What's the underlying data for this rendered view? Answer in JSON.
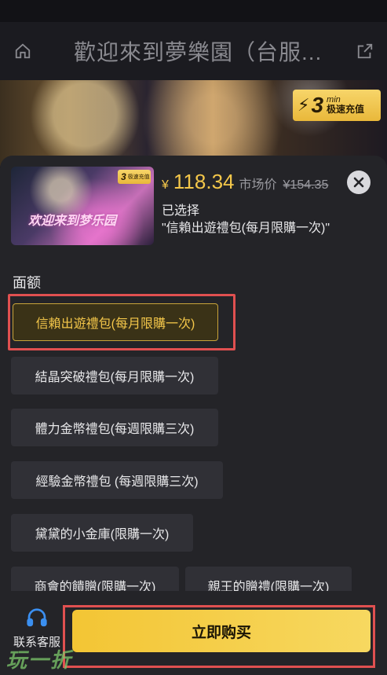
{
  "header": {
    "title": "歡迎來到夢樂園（台服..."
  },
  "banner": {
    "badge_number": "3",
    "badge_unit": "min",
    "badge_text": "极速充值"
  },
  "product": {
    "thumb_badge_number": "3",
    "thumb_badge_text": "极速充值",
    "thumb_logo": "欢迎来到梦乐园",
    "currency": "¥",
    "price": "118.34",
    "market_label": "市场价",
    "market_price": "¥154.35",
    "selected_label": "已选择",
    "selected_value": "\"信賴出遊禮包(每月限購一次)\""
  },
  "options_section": {
    "label": "面额",
    "options": [
      {
        "label": "信賴出遊禮包(每月限購一次)",
        "selected": true
      },
      {
        "label": "結晶突破禮包(每月限購一次)",
        "selected": false
      },
      {
        "label": "體力金幣禮包(每週限購三次)",
        "selected": false
      },
      {
        "label": "經驗金幣禮包 (每週限購三次)",
        "selected": false
      },
      {
        "label": "黛黛的小金庫(限購一次)",
        "selected": false
      },
      {
        "label": "商會的饋贈(限購一次)",
        "selected": false
      },
      {
        "label": "親王的贈禮(限購一次)",
        "selected": false
      }
    ]
  },
  "footer": {
    "support_label": "联系客服",
    "buy_label": "立即购买",
    "watermark": "玩一折"
  },
  "colors": {
    "accent": "#f4c74a",
    "highlight": "#e05050",
    "sheet": "#242428"
  }
}
